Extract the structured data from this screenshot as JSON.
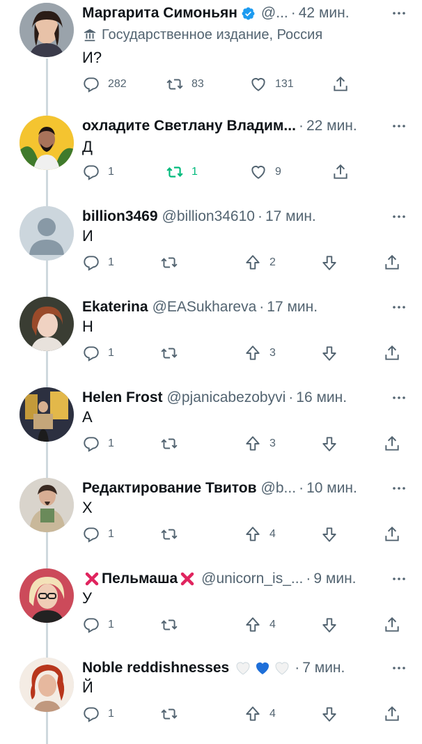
{
  "tweets": [
    {
      "name": "Маргарита Симоньян",
      "handle": "@...",
      "time": "42 мин.",
      "affiliation": "Государственное издание, Россия",
      "text": "И?",
      "verified": true,
      "type": "standard",
      "actions": {
        "reply": "282",
        "retweet": "83",
        "like": "131"
      }
    },
    {
      "name": "охладите Светлану Владим...",
      "handle": "",
      "time": "22 мин.",
      "text": "Д",
      "type": "standard",
      "retweet_active": true,
      "actions": {
        "reply": "1",
        "retweet": "1",
        "like": "9"
      }
    },
    {
      "name": "billion3469",
      "handle": "@billion34610",
      "time": "17 мин.",
      "text": "И",
      "type": "vote",
      "actions": {
        "reply": "1",
        "upvote": "2"
      }
    },
    {
      "name": "Ekaterina",
      "handle": "@EASukhareva",
      "time": "17 мин.",
      "text": "Н",
      "type": "vote",
      "actions": {
        "reply": "1",
        "upvote": "3"
      }
    },
    {
      "name": "Helen Frost",
      "handle": "@pjanicabezobyvi",
      "time": "16 мин.",
      "text": "А",
      "type": "vote",
      "actions": {
        "reply": "1",
        "upvote": "3"
      }
    },
    {
      "name": "Редактирование Твитов",
      "handle": "@b...",
      "time": "10 мин.",
      "text": "Х",
      "type": "vote",
      "actions": {
        "reply": "1",
        "upvote": "4"
      }
    },
    {
      "name": "Пельмаша",
      "handle": "@unicorn_is_...",
      "time": "9 мин.",
      "text": "У",
      "type": "vote",
      "name_emoji": "cross-mark",
      "actions": {
        "reply": "1",
        "upvote": "4"
      }
    },
    {
      "name": "Noble reddishnesses",
      "handle": "",
      "time": "7 мин.",
      "text": "Й",
      "type": "vote",
      "name_emoji": "hearts",
      "actions": {
        "reply": "1",
        "upvote": "4"
      }
    }
  ],
  "icons": {
    "reply": "reply-icon",
    "retweet": "retweet-icon",
    "like": "heart-icon",
    "share": "share-icon",
    "upvote": "upvote-icon",
    "downvote": "downvote-icon",
    "more": "more-icon",
    "verified": "verified-badge-icon",
    "affiliation": "government-building-icon"
  },
  "colors": {
    "text": "#0f1419",
    "secondary": "#536471",
    "thread_line": "#cfd9de",
    "verified": "#1d9bf0",
    "retweet_active": "#00ba7c",
    "cross": "#e0245e",
    "heart_blue": "#1e6fd9"
  }
}
